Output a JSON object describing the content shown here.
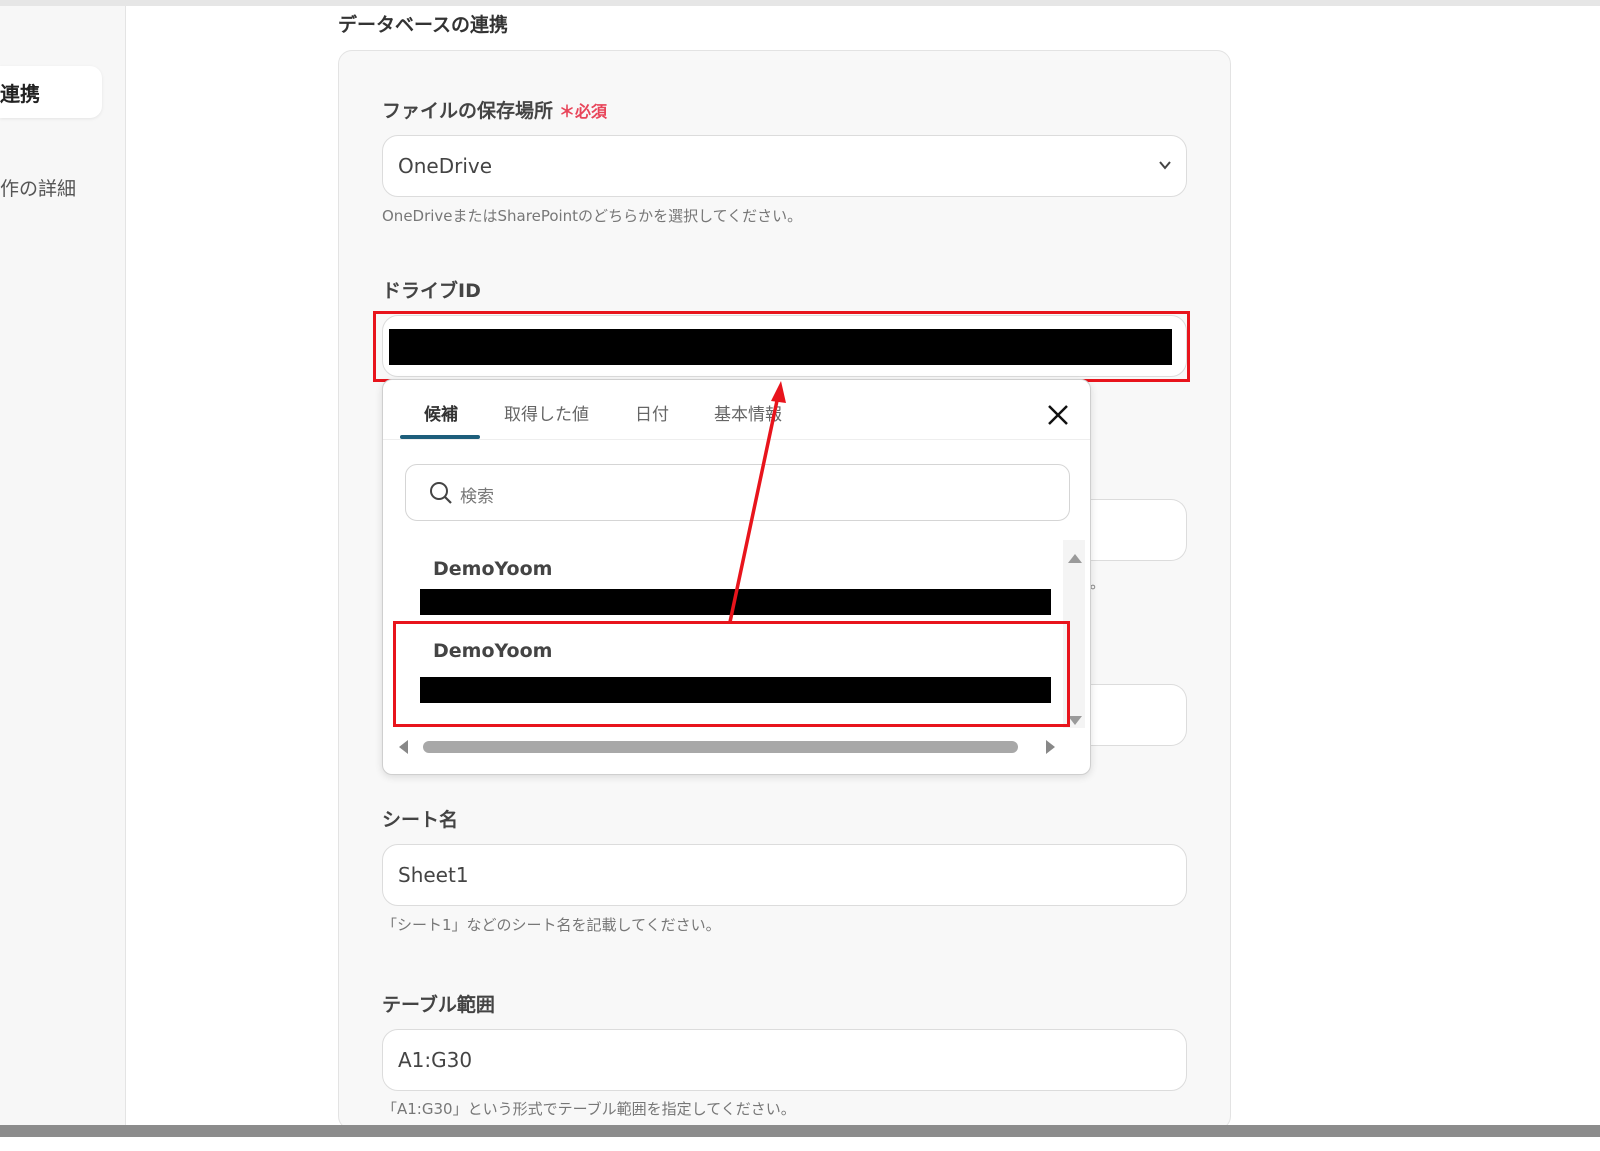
{
  "section": {
    "title": "データベースの連携"
  },
  "sidebar": {
    "active_item": "連携",
    "item2": "作の詳細"
  },
  "storage": {
    "label": "ファイルの保存場所",
    "required_mark": "＊必須",
    "value": "OneDrive",
    "help": "OneDriveまたはSharePointのどちらかを選択してください。"
  },
  "drive_id": {
    "label": "ドライブID"
  },
  "popup": {
    "tabs": [
      "候補",
      "取得した値",
      "日付",
      "基本情報"
    ],
    "active_tab": "候補",
    "search_placeholder": "検索",
    "options": [
      {
        "title": "DemoYoom"
      },
      {
        "title": "DemoYoom"
      }
    ]
  },
  "background_help_fragment": "い。",
  "sheet": {
    "label": "シート名",
    "value": "Sheet1",
    "help": "「シート1」などのシート名を記載してください。"
  },
  "table_range": {
    "label": "テーブル範囲",
    "value": "A1:G30",
    "help": "「A1:G30」という形式でテーブル範囲を指定してください。"
  },
  "colors": {
    "accent": "#1d5e7b",
    "highlight": "#e8141c",
    "required": "#e8455a"
  }
}
